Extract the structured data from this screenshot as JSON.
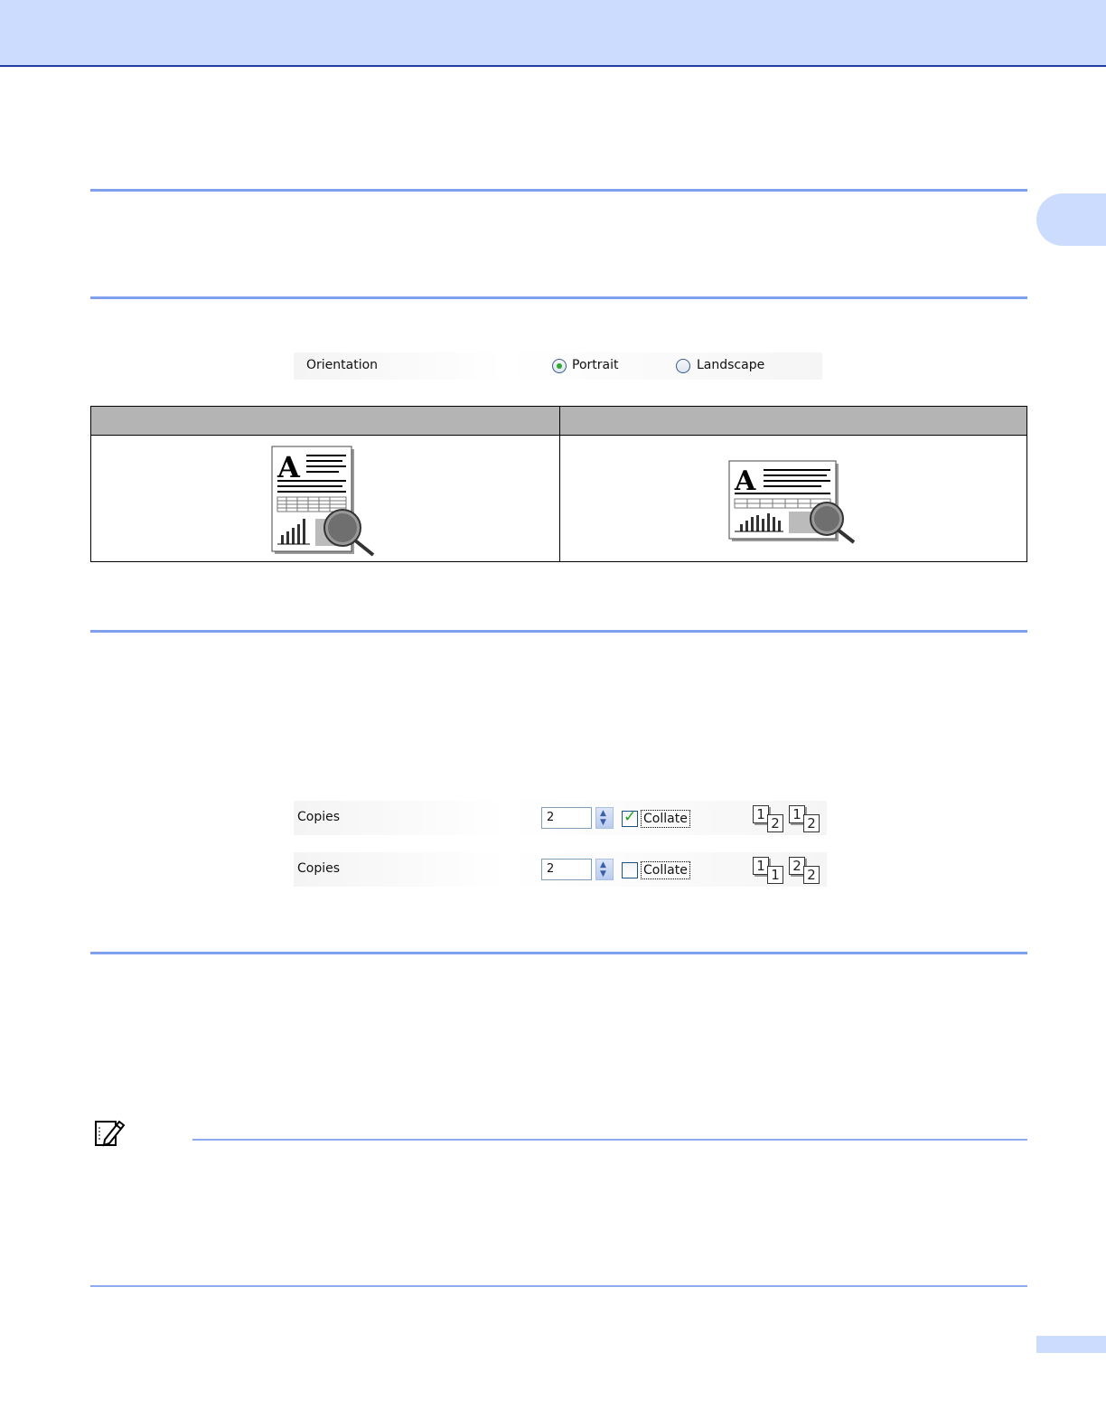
{
  "colors": {
    "band": "#ccdcff",
    "rule": "#7f9fef",
    "header_gray": "#b4b4b4"
  },
  "orientation_dialog": {
    "label": "Orientation",
    "portrait": "Portrait",
    "landscape": "Landscape",
    "selected": "Portrait"
  },
  "orientation_table": {
    "portrait_image": "portrait-page-icon",
    "landscape_image": "landscape-page-icon"
  },
  "copies_collated": {
    "label": "Copies",
    "value": "2",
    "collate": "Collate",
    "checked": true,
    "icon_pages": [
      "1",
      "2",
      "1",
      "2"
    ]
  },
  "copies_uncollated": {
    "label": "Copies",
    "value": "2",
    "collate": "Collate",
    "checked": false,
    "icon_pages": [
      "1",
      "1",
      "2",
      "2"
    ]
  },
  "note_icon": "note-pencil-icon"
}
